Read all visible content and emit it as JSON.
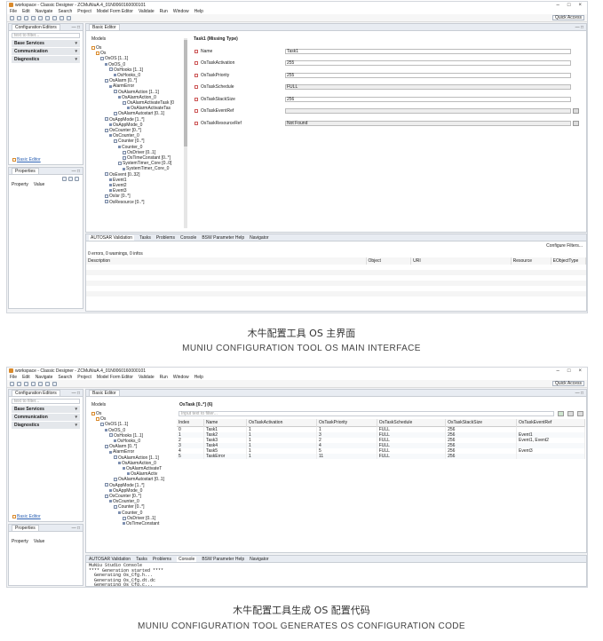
{
  "window": {
    "title": "workspace - Classic Designer - ZCMuNiuA.4_01N0060160000101",
    "min": "–",
    "max": "□",
    "close": "×"
  },
  "window2": {
    "title": "workspace - Classic Designer - ZCMuNiuA.4_01N0060160000101"
  },
  "menu": [
    "File",
    "Edit",
    "Navigate",
    "Search",
    "Project",
    "Model Form Editor",
    "Validate",
    "Run",
    "Window",
    "Help"
  ],
  "quick_access": "Quick Access",
  "config_editors": {
    "tab": "Configuration Editors",
    "filter": "text to filter...",
    "categories": [
      "Base Services",
      "Communication",
      "Diagnostics"
    ],
    "basic_editor_link": "Basic Editor"
  },
  "properties": {
    "tab": "Properties",
    "col_property": "Property",
    "col_value": "Value"
  },
  "basic_editor": {
    "tab": "Basic Editor",
    "models": "Models"
  },
  "tree1": [
    "Os",
    "Os",
    "OsOS [1..1]",
    "OsOS_0",
    "OsHooks [1..1]",
    "OsHooks_0",
    "OsAlarm [0..*]",
    "AlarmError",
    "OsAlarmAction [1..1]",
    "OsAlarmAction_0",
    "OsAlarmActivateTask [0",
    "OsAlarmActivateTas",
    "OsAlarmAutostart [0..1]",
    "OsAppMode [1..*]",
    "OsAppMode_0",
    "OsCounter [0..*]",
    "OsCounter_0",
    "Counter [0..*]",
    "Counter_0",
    "OsDriver [0..1]",
    "OsTimeConstant [0..*]",
    "SystemTimer_Core [0..0]",
    "SystemTimer_Core_0",
    "OsEvent [0..32]",
    "Event1",
    "Event2",
    "Event3",
    "OsIsr [0..*]",
    "OsResource [0..*]"
  ],
  "task_form": {
    "heading": "Task1 (Missing Type)",
    "rows": [
      {
        "name": "Name",
        "value": "Task1"
      },
      {
        "name": "OsTaskActivation",
        "value": "255"
      },
      {
        "name": "OsTaskPriority",
        "value": "255"
      },
      {
        "name": "OsTaskSchedule",
        "value": "FULL"
      },
      {
        "name": "OsTaskStackSize",
        "value": "256"
      },
      {
        "name": "OsTaskEventRef",
        "value": ""
      },
      {
        "name": "OsTaskResourceRef",
        "value": "Not Found"
      }
    ]
  },
  "bottom1": {
    "tabs": [
      "AUTOSAR Validation",
      "Tasks",
      "Problems",
      "Console",
      "BSW Parameter Help",
      "Navigator"
    ],
    "configure_filters": "Configure Filters...",
    "summary": "0 errors, 0 warnings, 0 infos",
    "cols": [
      "Description",
      "Object",
      "URI",
      "Resource",
      "EObjectType"
    ]
  },
  "captions": {
    "cn1": "木牛配置工具 OS 主界面",
    "en1": "MUNIU CONFIGURATION TOOL OS MAIN INTERFACE",
    "cn2": "木牛配置工具生成 OS 配置代码",
    "en2": "MUNIU CONFIGURATION TOOL GENERATES OS CONFIGURATION CODE"
  },
  "table2": {
    "heading": "OsTask [0..*] (6)",
    "search_placeholder": "Input text to filter...",
    "cols": [
      "Index",
      "Name",
      "OsTaskActivation",
      "OsTaskPriority",
      "OsTaskSchedule",
      "OsTaskStackSize",
      "OsTaskEventRef"
    ],
    "rows": [
      [
        "0",
        "Task1",
        "1",
        "1",
        "FULL",
        "256",
        ""
      ],
      [
        "1",
        "Task2",
        "1",
        "3",
        "FULL",
        "256",
        "Event1"
      ],
      [
        "2",
        "Task3",
        "1",
        "2",
        "FULL",
        "256",
        "Event1, Event2"
      ],
      [
        "3",
        "Task4",
        "1",
        "4",
        "FULL",
        "256",
        ""
      ],
      [
        "4",
        "Task5",
        "1",
        "5",
        "FULL",
        "256",
        "Event3"
      ],
      [
        "5",
        "TaskError",
        "1",
        "11",
        "FULL",
        "256",
        ""
      ]
    ]
  },
  "tree2": [
    "Os",
    "Os",
    "OsOS [1..1]",
    "OsOS_0",
    "OsHooks [1..1]",
    "OsHooks_0",
    "OsAlarm [0..*]",
    "AlarmError",
    "OsAlarmAction [1..1]",
    "OsAlarmAction_0",
    "OsAlarmActivateT",
    "OsAlarmActiv",
    "OsAlarmAutostart [0..1]",
    "OsAppMode [1..*]",
    "OsAppMode_0",
    "OsCounter [0..*]",
    "OsCounter_0",
    "Counter [0..*]",
    "Counter_0",
    "OsDriver [0..1]",
    "OsTimeConstant"
  ],
  "console": {
    "title": "MuNiu Studio Console",
    "lines": [
      "**** Generation started ****",
      "  Generating Os_Cfg.h...",
      "  Generating Os_Cfg.dt.dc",
      "  Generating Os_Cfg.c..."
    ]
  }
}
